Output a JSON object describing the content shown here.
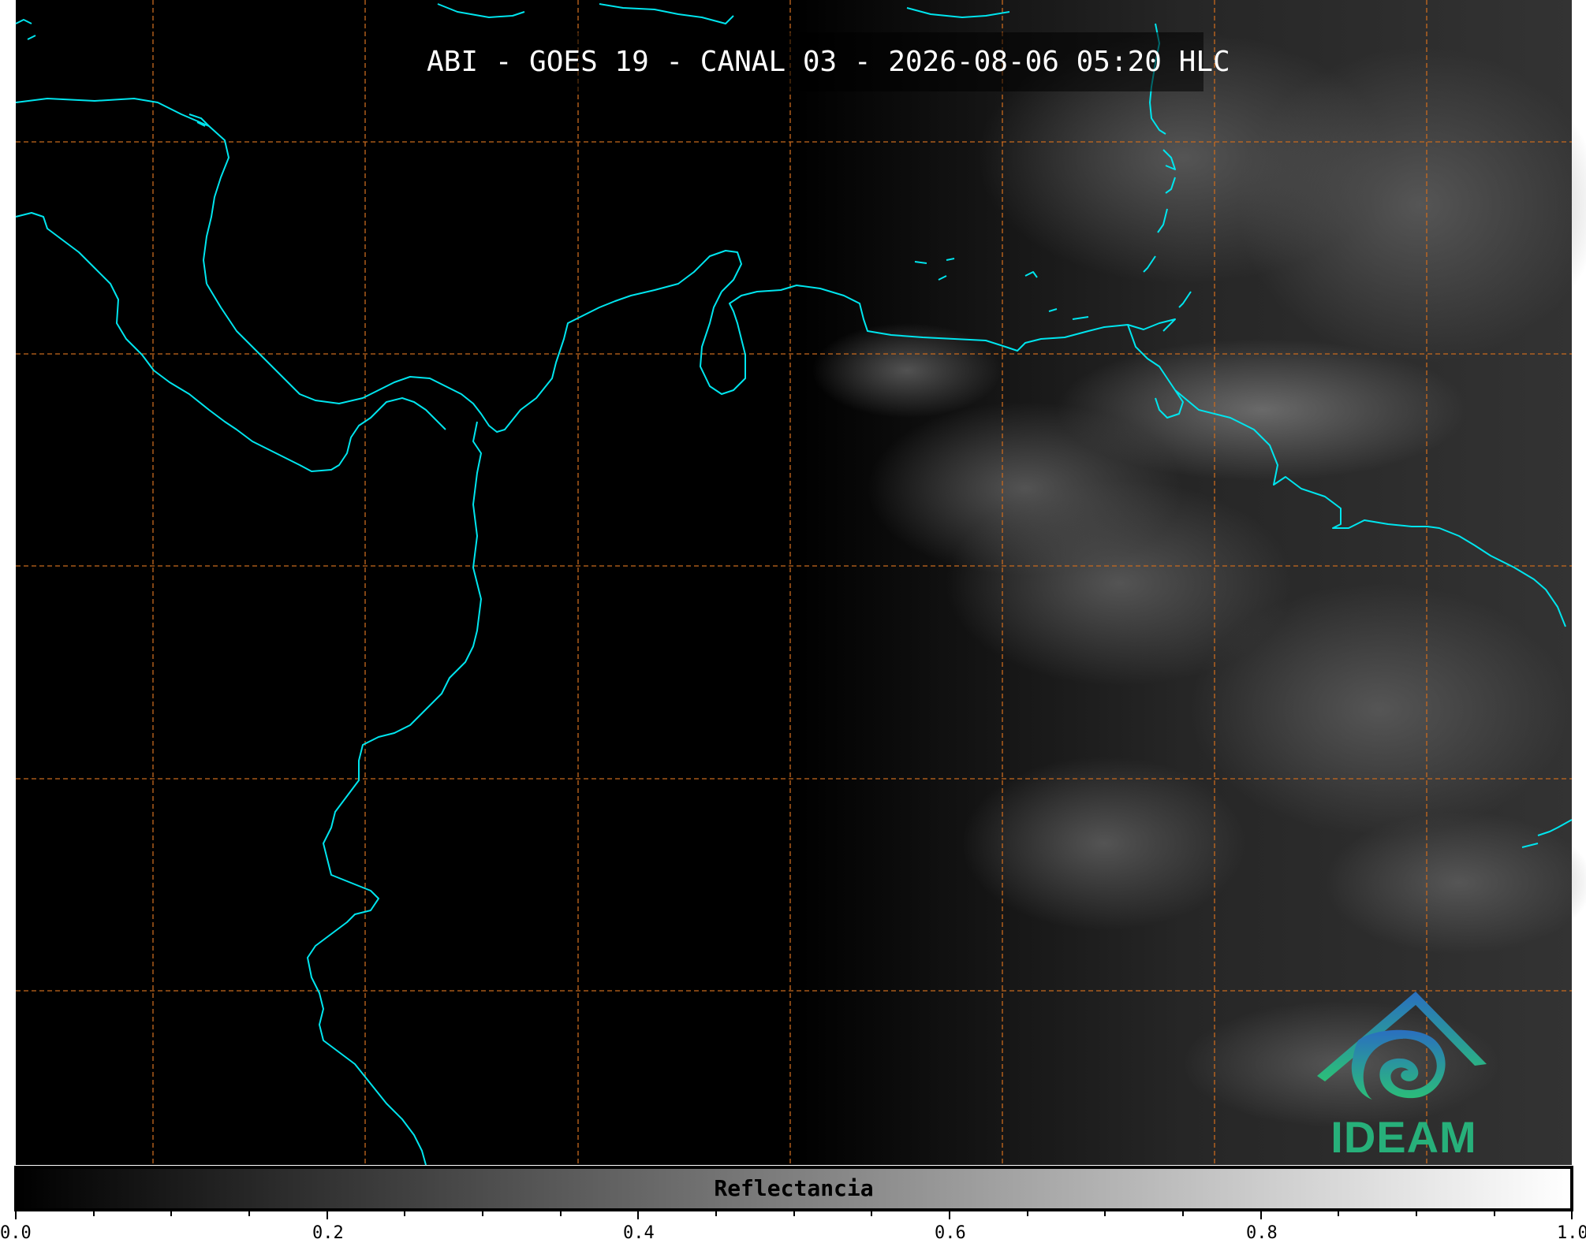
{
  "title": "ABI - GOES 19 - CANAL 03 - 2026-08-06 05:20 HLC",
  "colorbar": {
    "label": "Reflectancia",
    "ticks": [
      "0.0",
      "0.2",
      "0.4",
      "0.6",
      "0.8",
      "1.0"
    ],
    "range": [
      0.0,
      1.0
    ]
  },
  "logo": {
    "text": "IDEAM"
  },
  "colors": {
    "coastline": "#00e5ee",
    "gridline": "#d2691e",
    "background": "#000000",
    "logo_blue": "#2a7fb8",
    "logo_green": "#27b07a"
  }
}
